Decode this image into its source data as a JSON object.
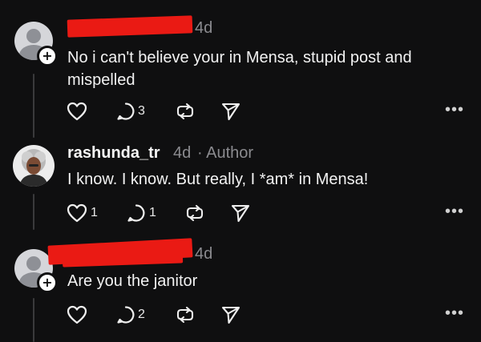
{
  "comments": [
    {
      "time": "4d",
      "text": "No i can't believe your in Mensa, stupid post and mispelled",
      "actions": {
        "like_count": "",
        "reply_count": "3"
      }
    },
    {
      "username": "rashunda_tr",
      "time": "4d",
      "author_tag": "· Author",
      "text": "I know. I know. But really, I *am* in Mensa!",
      "actions": {
        "like_count": "1",
        "reply_count": "1"
      }
    },
    {
      "time": "4d",
      "text": "Are you the janitor",
      "actions": {
        "like_count": "",
        "reply_count": "2"
      }
    }
  ],
  "icons": {
    "like": "heart-icon",
    "reply": "speech-bubble-icon",
    "repost": "repost-icon",
    "share": "send-icon",
    "more": "more-options-icon"
  },
  "colors": {
    "background": "#0f0f10",
    "redaction": "#ea1a14",
    "meta": "#8b8b8f"
  }
}
